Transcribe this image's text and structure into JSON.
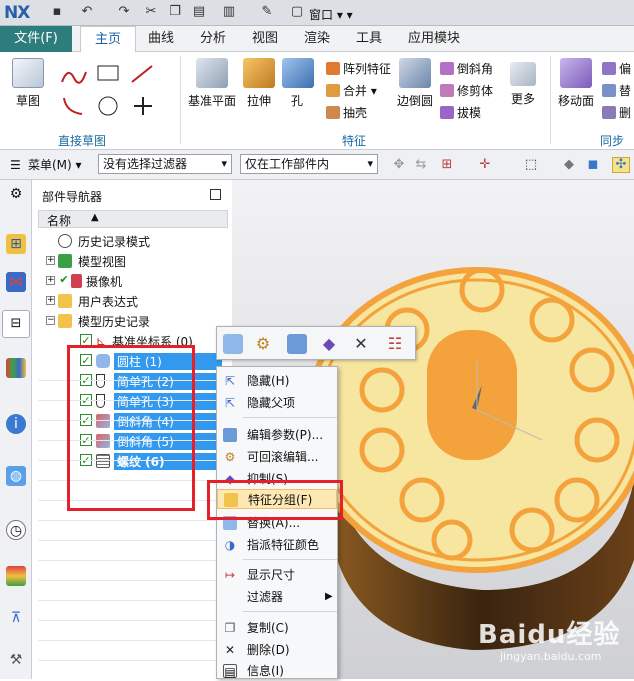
{
  "titlebar": {
    "logo": "NX",
    "window_menu": "窗口"
  },
  "ribbon_tabs": [
    {
      "label": "文件(F)"
    },
    {
      "label": "主页"
    },
    {
      "label": "曲线"
    },
    {
      "label": "分析"
    },
    {
      "label": "视图"
    },
    {
      "label": "渲染"
    },
    {
      "label": "工具"
    },
    {
      "label": "应用模块"
    }
  ],
  "ribbon": {
    "sketch": "草图",
    "group_direct_sketch": "直接草图",
    "datum_plane": "基准平面",
    "extrude": "拉伸",
    "hole": "孔",
    "pattern_feature": "阵列特征",
    "unite": "合并",
    "shell": "抽壳",
    "edge_blend": "边倒圆",
    "chamfer": "倒斜角",
    "trim_body": "修剪体",
    "draft": "拔模",
    "more": "更多",
    "group_feature": "特征",
    "move_face": "移动面",
    "partial_1": "偏",
    "partial_2": "替",
    "partial_3": "删",
    "group_sync": "同步建"
  },
  "selbar": {
    "menu": "菜单(M)",
    "filter": "没有选择过滤器",
    "scope": "仅在工作部件内"
  },
  "navigator": {
    "title": "部件导航器",
    "column_name": "名称",
    "rows": [
      {
        "label": "历史记录模式"
      },
      {
        "label": "模型视图"
      },
      {
        "label": "摄像机"
      },
      {
        "label": "用户表达式"
      },
      {
        "label": "模型历史记录"
      },
      {
        "label": "基准坐标系 (0)"
      },
      {
        "label": "圆柱 (1)"
      },
      {
        "label": "简单孔 (2)"
      },
      {
        "label": "简单孔 (3)"
      },
      {
        "label": "倒斜角 (4)"
      },
      {
        "label": "倒斜角 (5)"
      },
      {
        "label": "螺纹 (6)"
      }
    ]
  },
  "context_menu": [
    {
      "label": "隐藏(H)"
    },
    {
      "label": "隐藏父项"
    },
    {
      "label": "编辑参数(P)..."
    },
    {
      "label": "可回滚编辑..."
    },
    {
      "label": "抑制(S)"
    },
    {
      "label": "特征分组(F)"
    },
    {
      "label": "替换(A)..."
    },
    {
      "label": "指派特征颜色"
    },
    {
      "label": "显示尺寸"
    },
    {
      "label": "过滤器"
    },
    {
      "label": "复制(C)"
    },
    {
      "label": "删除(D)"
    },
    {
      "label": "信息(I)"
    }
  ],
  "watermark": {
    "brand": "Baidu经验",
    "url": "jingyan.baidu.com"
  },
  "colors": {
    "accent": "#2e7d7d",
    "selection": "#3399ee",
    "highlight": "#e6202a",
    "part": "#f7b94a"
  }
}
